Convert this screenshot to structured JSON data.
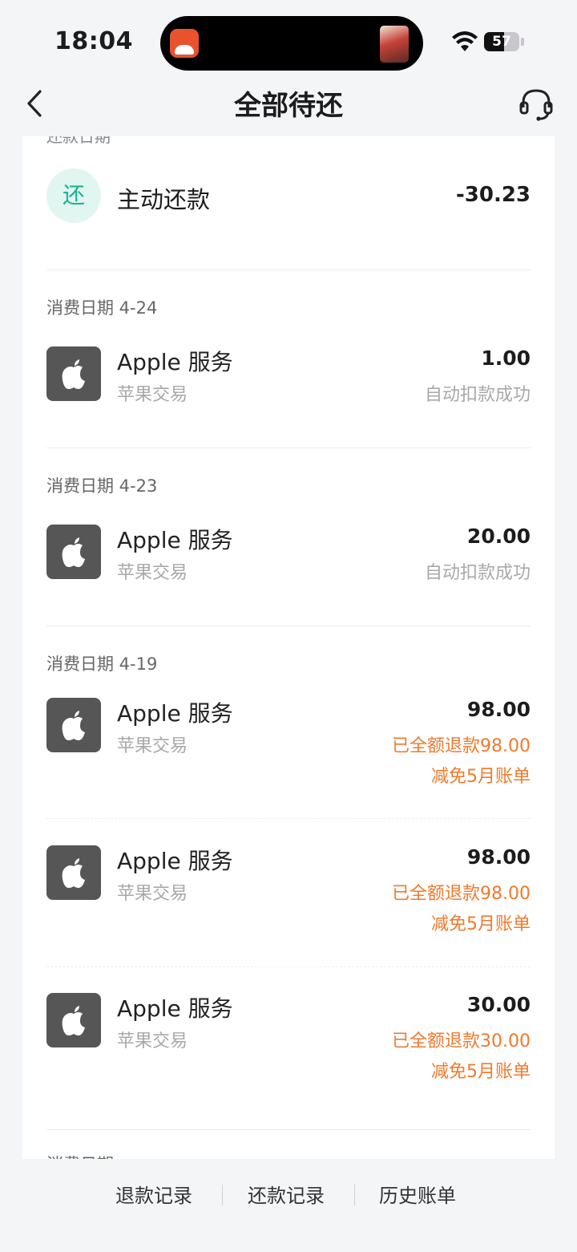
{
  "status_bar": {
    "time": "18:04",
    "battery": "57",
    "battery_level": 0.57
  },
  "nav": {
    "title": "全部待还"
  },
  "repayment": {
    "icon_text": "还",
    "label": "主动还款",
    "amount": "-30.23"
  },
  "groups": [
    {
      "date": "消费日期 4-24",
      "items": [
        {
          "merchant": "Apple 服务",
          "type": "苹果交易",
          "amount": "1.00",
          "status": "自动扣款成功"
        }
      ]
    },
    {
      "date": "消费日期 4-23",
      "items": [
        {
          "merchant": "Apple 服务",
          "type": "苹果交易",
          "amount": "20.00",
          "status": "自动扣款成功"
        }
      ]
    },
    {
      "date": "消费日期 4-19",
      "items": [
        {
          "merchant": "Apple 服务",
          "type": "苹果交易",
          "amount": "98.00",
          "status": "已全额退款98.00",
          "note": "减免5月账单"
        },
        {
          "merchant": "Apple 服务",
          "type": "苹果交易",
          "amount": "98.00",
          "status": "已全额退款98.00",
          "note": "减免5月账单"
        },
        {
          "merchant": "Apple 服务",
          "type": "苹果交易",
          "amount": "30.00",
          "status": "已全额退款30.00",
          "note": "减免5月账单"
        }
      ]
    }
  ],
  "bottom_links": [
    "退款记录",
    "还款记录",
    "历史账单"
  ],
  "colors": {
    "accent_green": "#1ab394",
    "refund_orange": "#f07a2d",
    "icon_gray": "#565656"
  }
}
